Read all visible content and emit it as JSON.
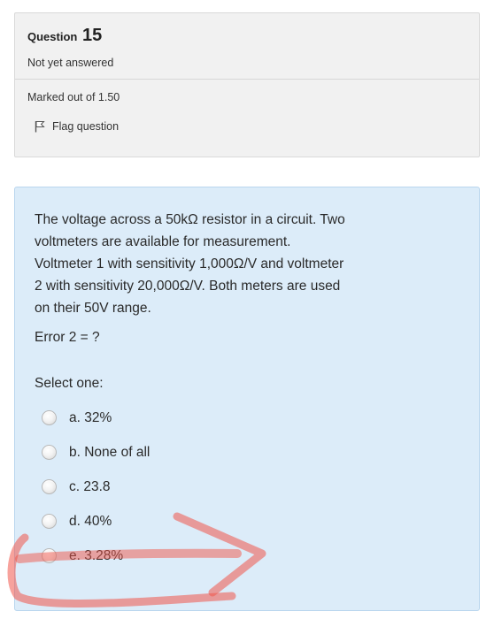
{
  "info": {
    "question_label": "Question",
    "question_number": "15",
    "state": "Not yet answered",
    "grade": "Marked out of 1.50",
    "flag_label": "Flag question"
  },
  "question": {
    "text_lines": [
      "The voltage across a 50kΩ resistor in a circuit. Two",
      "voltmeters are available for measurement.",
      "Voltmeter 1 with sensitivity 1,000Ω/V and voltmeter",
      "2 with sensitivity 20,000Ω/V. Both meters are used",
      "on their 50V range."
    ],
    "error_line": "Error 2 = ?",
    "prompt": "Select one:",
    "answers": [
      {
        "label": "a. 32%"
      },
      {
        "label": "b. None of all"
      },
      {
        "label": "c. 23.8"
      },
      {
        "label": "d. 40%"
      },
      {
        "label": "e. 3.28%"
      }
    ]
  },
  "colors": {
    "info_bg": "#f1f1f1",
    "content_bg": "#dcecf9",
    "annotation": "#f0564a"
  },
  "icons": {
    "flag": "flag-icon"
  }
}
